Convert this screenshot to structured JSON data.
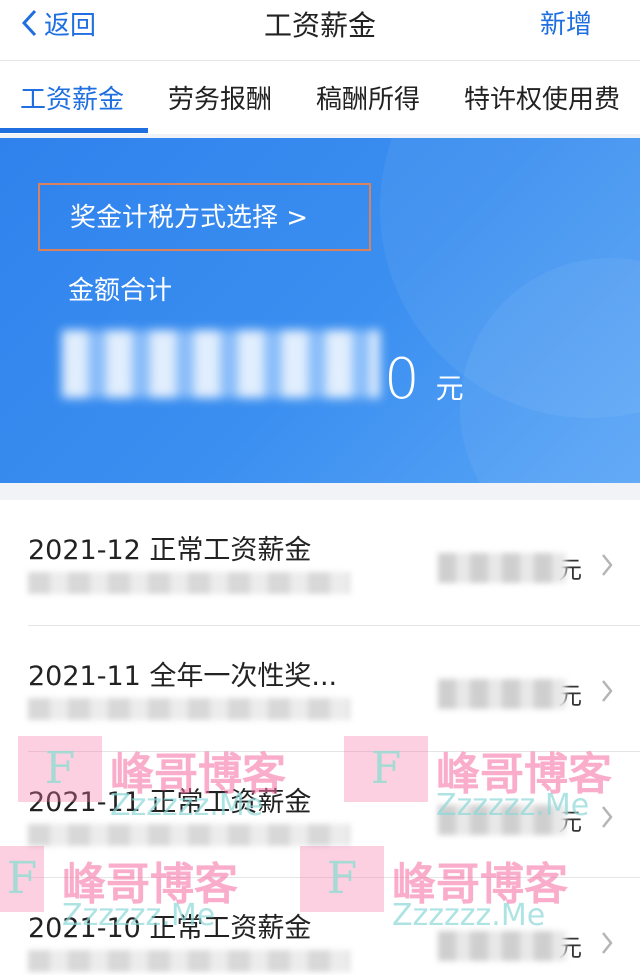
{
  "navbar": {
    "back_label": "返回",
    "title": "工资薪金",
    "add_label": "新增"
  },
  "tabs": [
    {
      "label": "工资薪金",
      "active": true
    },
    {
      "label": "劳务报酬",
      "active": false
    },
    {
      "label": "稿酬所得",
      "active": false
    },
    {
      "label": "特许权使用费",
      "active": false
    }
  ],
  "summary": {
    "tax_method_link": "奖金计税方式选择 >",
    "total_label": "金额合计",
    "total_visible_digit": "0",
    "total_unit": "元"
  },
  "records": [
    {
      "title": "2021-12 正常工资薪金",
      "unit": "元"
    },
    {
      "title": "2021-11 全年一次性奖...",
      "unit": "元"
    },
    {
      "title": "2021-11 正常工资薪金",
      "unit": "元"
    },
    {
      "title": "2021-10 正常工资薪金",
      "unit": "元"
    }
  ],
  "watermark": {
    "letter": "F",
    "name_cn": "峰哥博客",
    "name_en": "Zzzzzz.Me"
  },
  "colors": {
    "accent": "#1f6fe0",
    "banner": "#3b8ff0",
    "highlight_border": "#d9825b"
  }
}
